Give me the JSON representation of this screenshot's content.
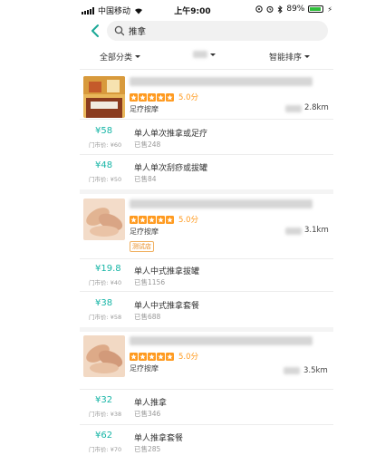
{
  "status_bar": {
    "carrier": "中国移动",
    "time": "上午9:00",
    "battery": "89%",
    "battery_level": 0.89
  },
  "search": {
    "query": "推拿"
  },
  "filters": {
    "category": "全部分类",
    "sort": "智能排序"
  },
  "shops": [
    {
      "rating": "5.0分",
      "category": "足疗按摩",
      "distance": "2.8km",
      "tag": "",
      "deals": [
        {
          "price": "¥58",
          "original": "门市价: ¥60",
          "title": "单人单次推拿或足疗",
          "sold": "已售248"
        },
        {
          "price": "¥48",
          "original": "门市价: ¥50",
          "title": "单人单次刮痧或拔罐",
          "sold": "已售84"
        }
      ]
    },
    {
      "rating": "5.0分",
      "category": "足疗按摩",
      "distance": "3.1km",
      "tag": "测试店",
      "deals": [
        {
          "price": "¥19.8",
          "original": "门市价: ¥40",
          "title": "单人中式推拿拔罐",
          "sold": "已售1156"
        },
        {
          "price": "¥38",
          "original": "门市价: ¥58",
          "title": "单人中式推拿套餐",
          "sold": "已售688"
        }
      ]
    },
    {
      "rating": "5.0分",
      "category": "足疗按摩",
      "distance": "3.5km",
      "tag": "",
      "deals": [
        {
          "price": "¥32",
          "original": "门市价: ¥38",
          "title": "单人推拿",
          "sold": "已售346"
        },
        {
          "price": "¥62",
          "original": "门市价: ¥70",
          "title": "单人推拿套餐",
          "sold": "已售285"
        }
      ]
    }
  ],
  "colors": {
    "accent": "#16b5a6",
    "star": "#ff9a1f",
    "back_arrow": "#1aa896"
  }
}
